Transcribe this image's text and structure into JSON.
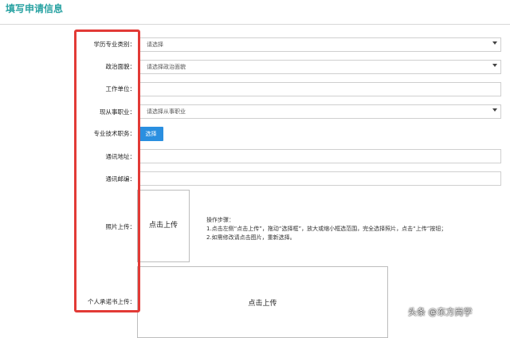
{
  "header": {
    "title": "填写申请信息"
  },
  "form": {
    "degree_category": {
      "label": "学历专业类别：",
      "value": "请选择"
    },
    "political_status": {
      "label": "政治面貌：",
      "value": "请选择政治面貌"
    },
    "work_unit": {
      "label": "工作单位：",
      "value": ""
    },
    "current_job": {
      "label": "现从事职业：",
      "value": "请选择从事职业"
    },
    "technical_title": {
      "label": "专业技术职务：",
      "button": "选择"
    },
    "address": {
      "label": "通讯地址：",
      "value": ""
    },
    "postcode": {
      "label": "通讯邮编：",
      "value": ""
    },
    "photo": {
      "label": "照片上传：",
      "upload_label": "点击上传",
      "instructions": [
        "操作步骤：",
        "1.点击左侧“点击上传”，拖动“选择框”，放大或缩小框选范围，完全选择照片，点击“上传”按钮；",
        "2.如需修改请点击图片，重新选择。"
      ]
    },
    "commitment": {
      "label": "个人承诺书上传：",
      "upload_label": "点击上传"
    }
  },
  "watermark": "头条 @东方尚学",
  "colors": {
    "title": "#2aa3a3",
    "button": "#2a8fe0",
    "highlight": "#e23a36"
  }
}
